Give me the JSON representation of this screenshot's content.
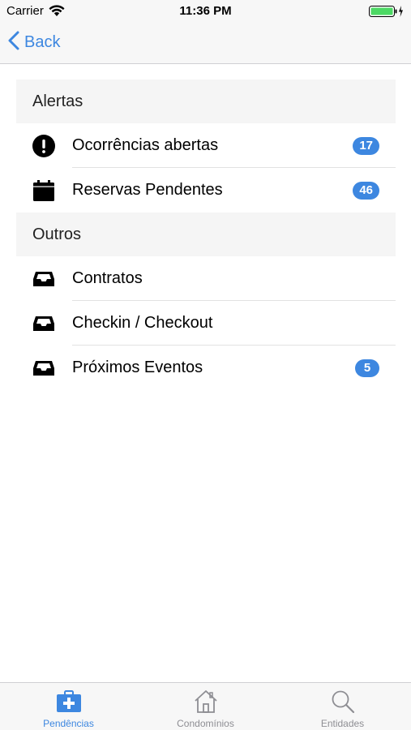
{
  "status_bar": {
    "carrier": "Carrier",
    "time": "11:36 PM",
    "battery_color": "#4cd964"
  },
  "nav": {
    "back_label": "Back"
  },
  "accent_color": "#3d87e0",
  "sections": [
    {
      "title": "Alertas",
      "items": [
        {
          "label": "Ocorrências abertas",
          "icon": "exclamation-icon",
          "badge": "17"
        },
        {
          "label": "Reservas Pendentes",
          "icon": "calendar-icon",
          "badge": "46"
        }
      ]
    },
    {
      "title": "Outros",
      "items": [
        {
          "label": "Contratos",
          "icon": "inbox-icon",
          "badge": ""
        },
        {
          "label": "Checkin / Checkout",
          "icon": "inbox-icon",
          "badge": ""
        },
        {
          "label": "Próximos Eventos",
          "icon": "inbox-icon",
          "badge": "5"
        }
      ]
    }
  ],
  "tab_bar": {
    "tabs": [
      {
        "label": "Pendências",
        "icon": "medical-kit-icon",
        "active": true
      },
      {
        "label": "Condomínios",
        "icon": "house-icon",
        "active": false
      },
      {
        "label": "Entidades",
        "icon": "search-icon",
        "active": false
      }
    ]
  }
}
